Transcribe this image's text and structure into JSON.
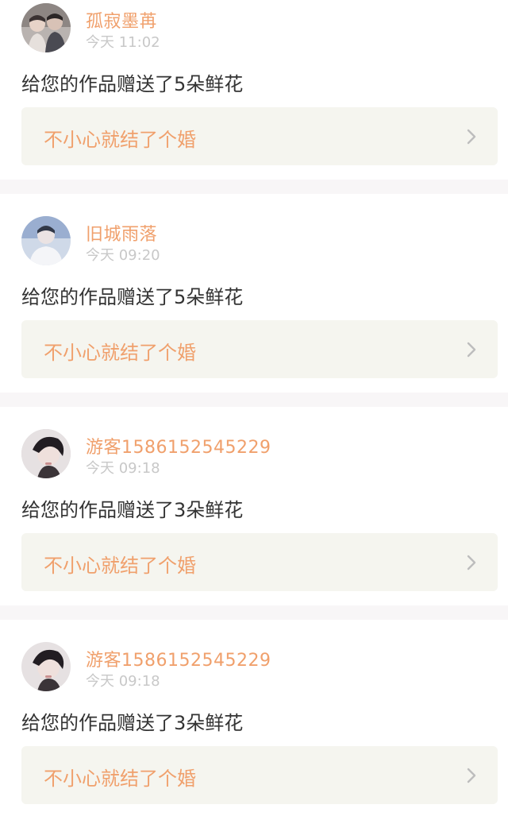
{
  "colors": {
    "accent": "#f0a06c",
    "time": "#c8c8c8",
    "message": "#333333",
    "card_link_bg": "#f5f5ef",
    "divider": "#f8f6f7"
  },
  "notifications": [
    {
      "username": "孤寂墨苒",
      "time": "今天 11:02",
      "message": "给您的作品赠送了5朵鲜花",
      "work_title": "不小心就结了个婚",
      "avatar_icon": "user-avatar-image",
      "chevron_icon": "chevron-right-icon"
    },
    {
      "username": "旧城雨落",
      "time": "今天 09:20",
      "message": "给您的作品赠送了5朵鲜花",
      "work_title": "不小心就结了个婚",
      "avatar_icon": "user-avatar-image",
      "chevron_icon": "chevron-right-icon"
    },
    {
      "username": "游客1586152545229",
      "time": "今天 09:18",
      "message": "给您的作品赠送了3朵鲜花",
      "work_title": "不小心就结了个婚",
      "avatar_icon": "user-avatar-image",
      "chevron_icon": "chevron-right-icon"
    },
    {
      "username": "游客1586152545229",
      "time": "今天 09:18",
      "message": "给您的作品赠送了3朵鲜花",
      "work_title": "不小心就结了个婚",
      "avatar_icon": "user-avatar-image",
      "chevron_icon": "chevron-right-icon"
    }
  ]
}
